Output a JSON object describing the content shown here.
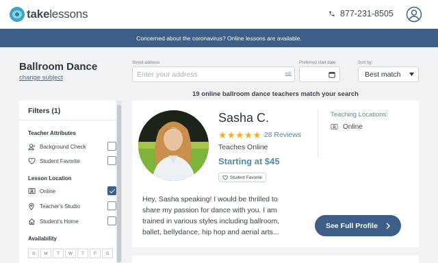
{
  "header": {
    "logo_prefix": "take",
    "logo_suffix": "lessons",
    "phone": "877-231-8505"
  },
  "banner": {
    "text": "Concerned about the coronavirus? Online lessons are available."
  },
  "subject": {
    "title": "Ballroom Dance",
    "change_link": "change subject"
  },
  "search": {
    "address_label": "Street address",
    "address_placeholder": "Enter your address",
    "edit_link": "edit",
    "date_label": "Preferred start date",
    "sort_label": "Sort by:",
    "sort_value": "Best match",
    "match_count": "19 online ballroom dance teachers match your search"
  },
  "filters": {
    "title": "Filters (1)",
    "groups": [
      {
        "title": "Teacher Attributes",
        "items": [
          {
            "label": "Background Check",
            "icon": "person-check-icon",
            "checked": false
          },
          {
            "label": "Student Favorite",
            "icon": "heart-icon",
            "checked": false
          }
        ]
      },
      {
        "title": "Lesson Location",
        "items": [
          {
            "label": "Online",
            "icon": "video-icon",
            "checked": true
          },
          {
            "label": "Teacher's Studio",
            "icon": "map-pin-icon",
            "checked": false
          },
          {
            "label": "Student's Home",
            "icon": "home-icon",
            "checked": false
          }
        ]
      },
      {
        "title": "Availability",
        "days": [
          "S",
          "M",
          "T",
          "W",
          "T",
          "F",
          "S"
        ]
      }
    ]
  },
  "teacher": {
    "name": "Sasha C.",
    "rating": 5,
    "reviews": "28 Reviews",
    "teaches": "Teaches Online",
    "price": "Starting at $45",
    "badge": "Student Favorite",
    "locations_title": "Teaching Locations:",
    "locations": [
      "Online"
    ],
    "bio": "Hey, Sasha speaking! I would be thrilled to share my passion for dance with you. I am trained in various styles including ballroom, ballet, bellydance, hip hop and aerial arts...",
    "cta": "See Full Profile"
  },
  "colors": {
    "brand_navy": "#3d5e86",
    "accent_teal": "#4b8fa7",
    "star_gold": "#f2b01e"
  }
}
